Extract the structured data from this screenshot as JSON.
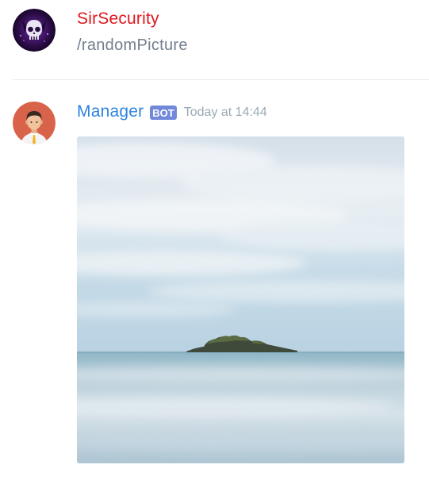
{
  "messages": [
    {
      "author": "SirSecurity",
      "author_color": "#e0161c",
      "avatar_icon": "skull-avatar-icon",
      "content": "/randomPicture"
    },
    {
      "author": "Manager",
      "author_color": "#2e84e0",
      "avatar_icon": "businessman-avatar-icon",
      "bot_tag": "BOT",
      "timestamp": "Today at 14:44",
      "attachment_icon": "seascape-island-image"
    }
  ]
}
